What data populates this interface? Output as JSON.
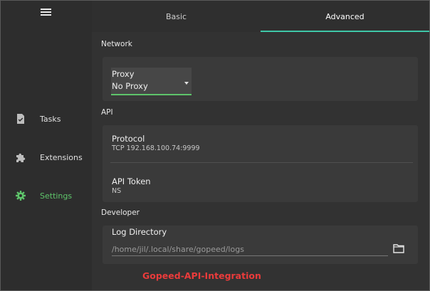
{
  "sidebar": {
    "items": [
      {
        "label": "Tasks",
        "icon": "task-icon"
      },
      {
        "label": "Extensions",
        "icon": "puzzle-icon"
      },
      {
        "label": "Settings",
        "icon": "gear-icon",
        "active": true
      }
    ]
  },
  "tabs": [
    {
      "label": "Basic"
    },
    {
      "label": "Advanced",
      "active": true
    }
  ],
  "network": {
    "section_title": "Network",
    "proxy": {
      "label": "Proxy",
      "value": "No Proxy"
    }
  },
  "api": {
    "section_title": "API",
    "protocol": {
      "label": "Protocol",
      "value": "TCP 192.168.100.74:9999"
    },
    "token": {
      "label": "API Token",
      "value": "NS"
    }
  },
  "developer": {
    "section_title": "Developer",
    "log_directory": {
      "label": "Log Directory",
      "value": "/home/jil/.local/share/gopeed/logs"
    }
  },
  "watermark": "Gopeed-API-Integration",
  "colors": {
    "accent": "#5ec46a",
    "tab_indicator": "#3fc7a8",
    "watermark": "#ea3b3b"
  }
}
